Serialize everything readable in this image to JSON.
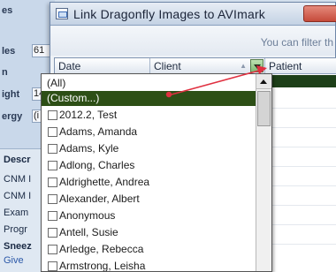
{
  "background_form": {
    "labels": [
      "es",
      "les",
      "n",
      "ight",
      "ergy"
    ],
    "field_values": [
      "",
      "61",
      "",
      "14",
      "(i"
    ],
    "section_title": "Descr",
    "items": [
      "CNM I",
      "CNM I",
      "Exam",
      "Progr",
      "Sneez",
      "Give"
    ]
  },
  "dialog": {
    "title": "Link Dragonfly Images to AVImark",
    "filter_hint": "You can filter th",
    "columns": [
      "Date",
      "Client",
      "Patient"
    ]
  },
  "dropdown": {
    "special_items": [
      "(All)",
      "(Custom...)"
    ],
    "selected_index": 1,
    "items": [
      "2012.2, Test",
      "Adams, Amanda",
      "Adams, Kyle",
      "Adlong, Charles",
      "Aldrighette, Andrea",
      "Alexander, Albert",
      "Anonymous",
      "Antell, Susie",
      "Arledge, Rebecca",
      "Armstrong, Leisha"
    ]
  },
  "colors": {
    "selection": "#2d4f16",
    "annotation": "#e03040"
  }
}
